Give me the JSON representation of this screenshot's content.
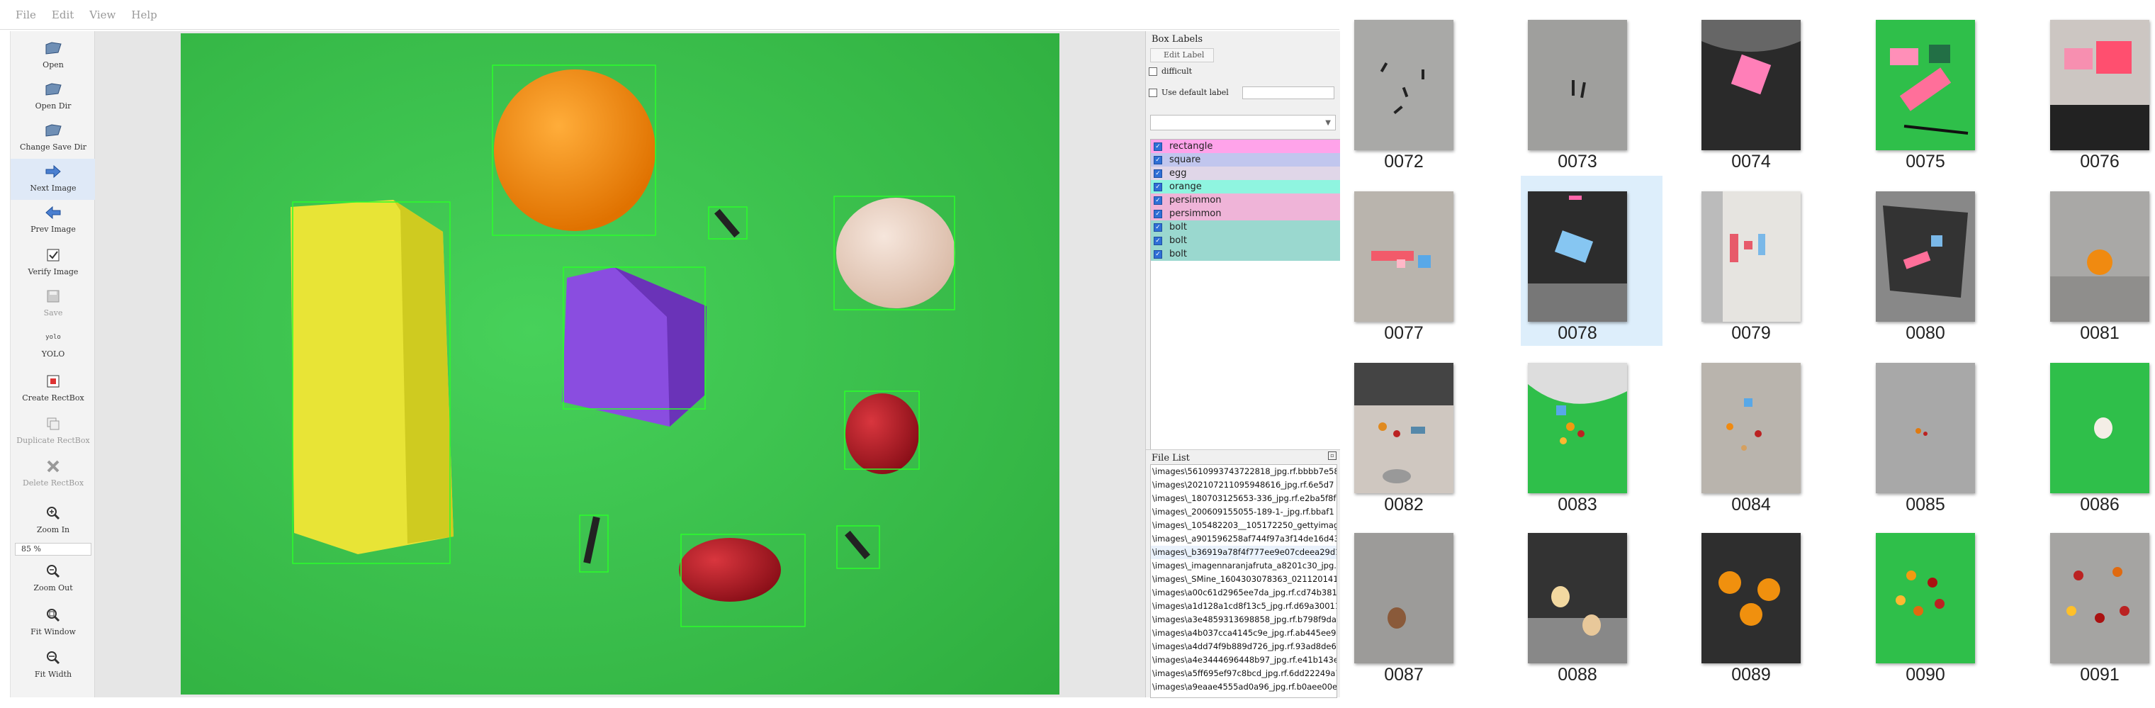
{
  "menu": [
    "File",
    "Edit",
    "View",
    "Help"
  ],
  "toolbar": {
    "open": "Open",
    "open_dir": "Open Dir",
    "change_save_dir": "Change Save Dir",
    "next_image": "Next Image",
    "prev_image": "Prev Image",
    "verify_image": "Verify Image",
    "save": "Save",
    "format_icon_text": "yolo",
    "format": "YOLO",
    "create_rectbox": "Create RectBox",
    "duplicate_rectbox": "Duplicate RectBox",
    "delete_rectbox": "Delete RectBox",
    "zoom_in": "Zoom In",
    "zoom_value": "85 %",
    "zoom_out": "Zoom Out",
    "fit_window": "Fit Window",
    "fit_width": "Fit Width"
  },
  "box_labels": {
    "title": "Box Labels",
    "edit_label": "Edit Label",
    "difficult": "difficult",
    "use_default_label": "Use default label",
    "items": [
      {
        "label": "rectangle",
        "color": "#ffa3ea"
      },
      {
        "label": "square",
        "color": "#c1c6ee"
      },
      {
        "label": "egg",
        "color": "#e0d6e8"
      },
      {
        "label": "orange",
        "color": "#8ff5e0"
      },
      {
        "label": "persimmon",
        "color": "#efb4d8"
      },
      {
        "label": "persimmon",
        "color": "#efb4d8"
      },
      {
        "label": "bolt",
        "color": "#9ad8cf"
      },
      {
        "label": "bolt",
        "color": "#9ad8cf"
      },
      {
        "label": "bolt",
        "color": "#9ad8cf"
      }
    ]
  },
  "file_list": {
    "title": "File List",
    "files": [
      "\\images\\5610993743722818_jpg.rf.bbbb7e58",
      "\\images\\202107211095948616_jpg.rf.6e5d7",
      "\\images\\_180703125653-336_jpg.rf.e2ba5f8f",
      "\\images\\_200609155055-189-1-_jpg.rf.bbaf1",
      "\\images\\_105482203__105172250_gettyimage",
      "\\images\\_a901596258af744f97a3f14de16d43",
      "\\images\\_b36919a78f4f777ee9e07cdeea29d1",
      "\\images\\_imagennaranjafruta_a8201c30_jpg.r",
      "\\images\\_SMine_1604303078363_0211201411",
      "\\images\\a00c61d2965ee7da_jpg.rf.cd74b381",
      "\\images\\a1d128a1cd8f13c5_jpg.rf.d69a30011",
      "\\images\\a3e4859313698858_jpg.rf.b798f9da",
      "\\images\\a4b037cca4145c9e_jpg.rf.ab445ee94",
      "\\images\\a4dd74f9b889d726_jpg.rf.93ad8de6",
      "\\images\\a4e3444696448b97_jpg.rf.e41b143e",
      "\\images\\a5ff695ef97c8bcd_jpg.rf.6dd22249a7",
      "\\images\\a9eaae4555ad0a96_jpg.rf.b0aee00e"
    ]
  },
  "gallery": [
    {
      "name": "0072",
      "kind": "bolts-gray"
    },
    {
      "name": "0073",
      "kind": "bolts-gray2"
    },
    {
      "name": "0074",
      "kind": "pink-on-dark"
    },
    {
      "name": "0075",
      "kind": "green-pink"
    },
    {
      "name": "0076",
      "kind": "pink-gray"
    },
    {
      "name": "0077",
      "kind": "speckled-blocks"
    },
    {
      "name": "0078",
      "kind": "blue-on-dark"
    },
    {
      "name": "0079",
      "kind": "white-door"
    },
    {
      "name": "0080",
      "kind": "dark-blocks"
    },
    {
      "name": "0081",
      "kind": "orange-gray"
    },
    {
      "name": "0082",
      "kind": "desk"
    },
    {
      "name": "0083",
      "kind": "green-mixed"
    },
    {
      "name": "0084",
      "kind": "speckled-items"
    },
    {
      "name": "0085",
      "kind": "gray-small"
    },
    {
      "name": "0086",
      "kind": "green-egg"
    },
    {
      "name": "0087",
      "kind": "gray-egg"
    },
    {
      "name": "0088",
      "kind": "dark-eggs"
    },
    {
      "name": "0089",
      "kind": "dark-oranges"
    },
    {
      "name": "0090",
      "kind": "green-fruits"
    },
    {
      "name": "0091",
      "kind": "gray-fruits"
    }
  ],
  "colors": {
    "accent": "#2f6fd6",
    "box_stroke": "#2bff2b",
    "photo_bg": "#3cc24a"
  }
}
